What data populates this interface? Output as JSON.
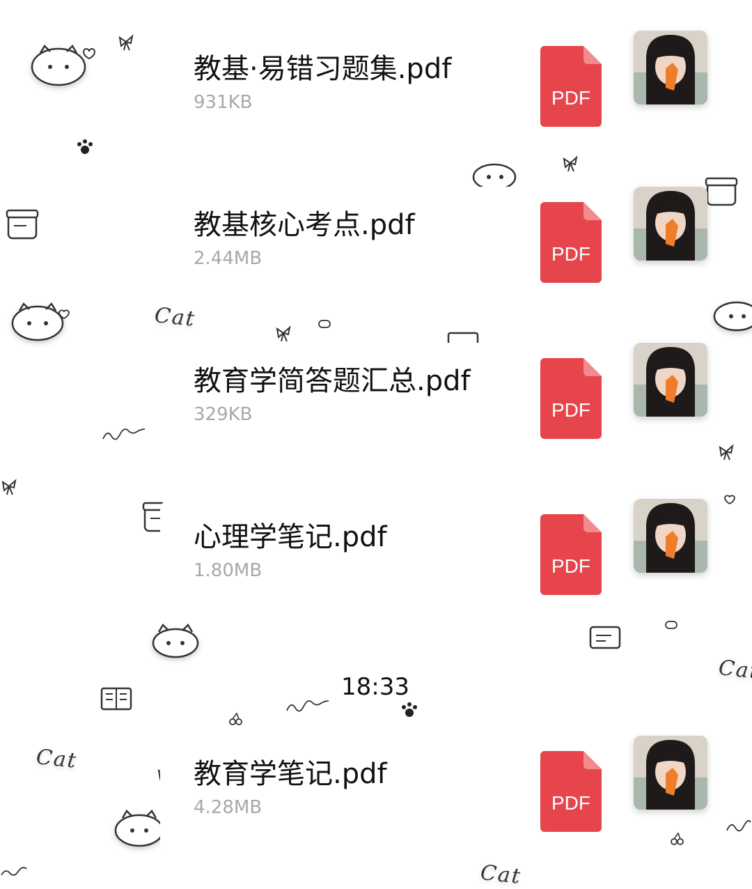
{
  "chat": {
    "messages": [
      {
        "file_name": "教基·易错习题集.pdf",
        "file_size": "931KB",
        "file_type": "PDF"
      },
      {
        "file_name": "教基核心考点.pdf",
        "file_size": "2.44MB",
        "file_type": "PDF"
      },
      {
        "file_name": "教育学简答题汇总.pdf",
        "file_size": "329KB",
        "file_type": "PDF"
      },
      {
        "file_name": "心理学笔记.pdf",
        "file_size": "1.80MB",
        "file_type": "PDF"
      },
      {
        "file_name": "教育学笔记.pdf",
        "file_size": "4.28MB",
        "file_type": "PDF"
      }
    ],
    "timestamp": "18:33"
  },
  "background_stickers": {
    "words": [
      "Cat",
      "Cat",
      "Cat",
      "Cat"
    ]
  },
  "colors": {
    "pdf_red": "#e5454b",
    "file_size_gray": "#a8a8a8"
  }
}
